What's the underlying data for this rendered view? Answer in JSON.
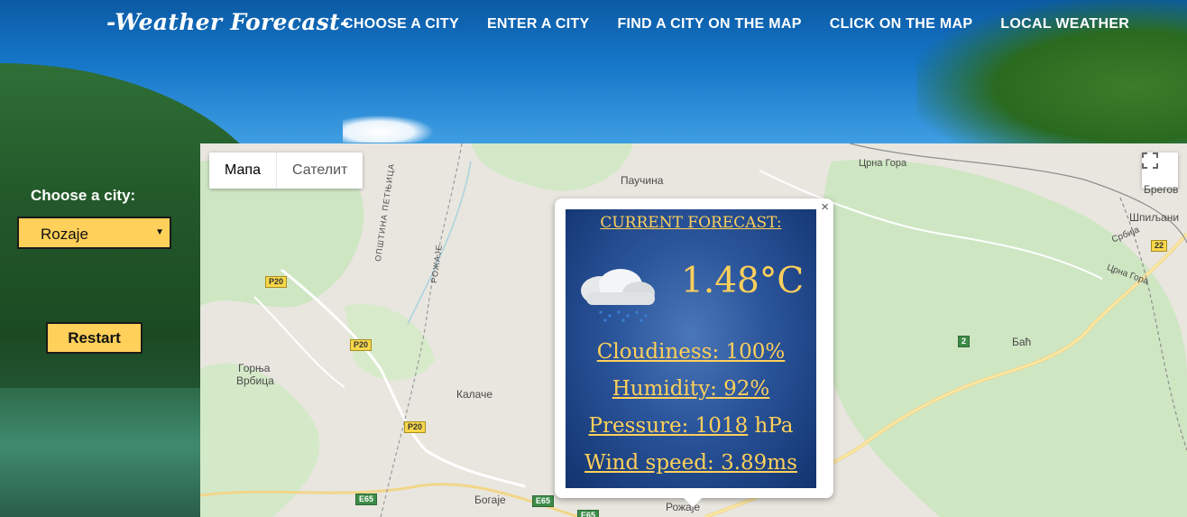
{
  "header": {
    "logo": "-Weather Forecast-",
    "nav": [
      "CHOOSE A CITY",
      "ENTER A CITY",
      "FIND A CITY ON THE MAP",
      "CLICK ON THE MAP",
      "LOCAL WEATHER"
    ]
  },
  "sidebar": {
    "choose_label": "Choose a city:",
    "selected_city": "Rozaje",
    "restart_label": "Restart"
  },
  "map": {
    "type_buttons": [
      "Мапа",
      "Сателит"
    ],
    "labels": {
      "pauchina": "Паучина",
      "crna_gora_top": "Црна Гора",
      "bregovi": "Брегов",
      "shpiljani": "Шпиљани",
      "srbija": "Србија",
      "crna_gora_right": "Црна Гора",
      "bac": "Баћ",
      "gornja": "Горња",
      "vrbica": "Врбица",
      "kalache": "Калаче",
      "bogaje": "Богаје",
      "rozhaje": "Рожаје",
      "opshtina": "ОПШТИНА ПЕТЊИЦА",
      "rozhaje_vertical": "РОЖАЈЕ",
      "shield_p20": "P20",
      "shield_e65": "E65",
      "shield_22": "22",
      "shield_2": "2"
    }
  },
  "popup": {
    "title": "CURRENT FORECAST:",
    "temperature": "1.48°C",
    "cloudiness_label": "Cloudiness:",
    "cloudiness_value": "100%",
    "humidity_label": "Humidity:",
    "humidity_value": "92%",
    "pressure_label": "Pressure:",
    "pressure_value": "1018",
    "pressure_unit": "hPa",
    "wind_label": "Wind speed:",
    "wind_value": "3.89ms",
    "close": "×",
    "icon": "rain-cloud-icon"
  }
}
